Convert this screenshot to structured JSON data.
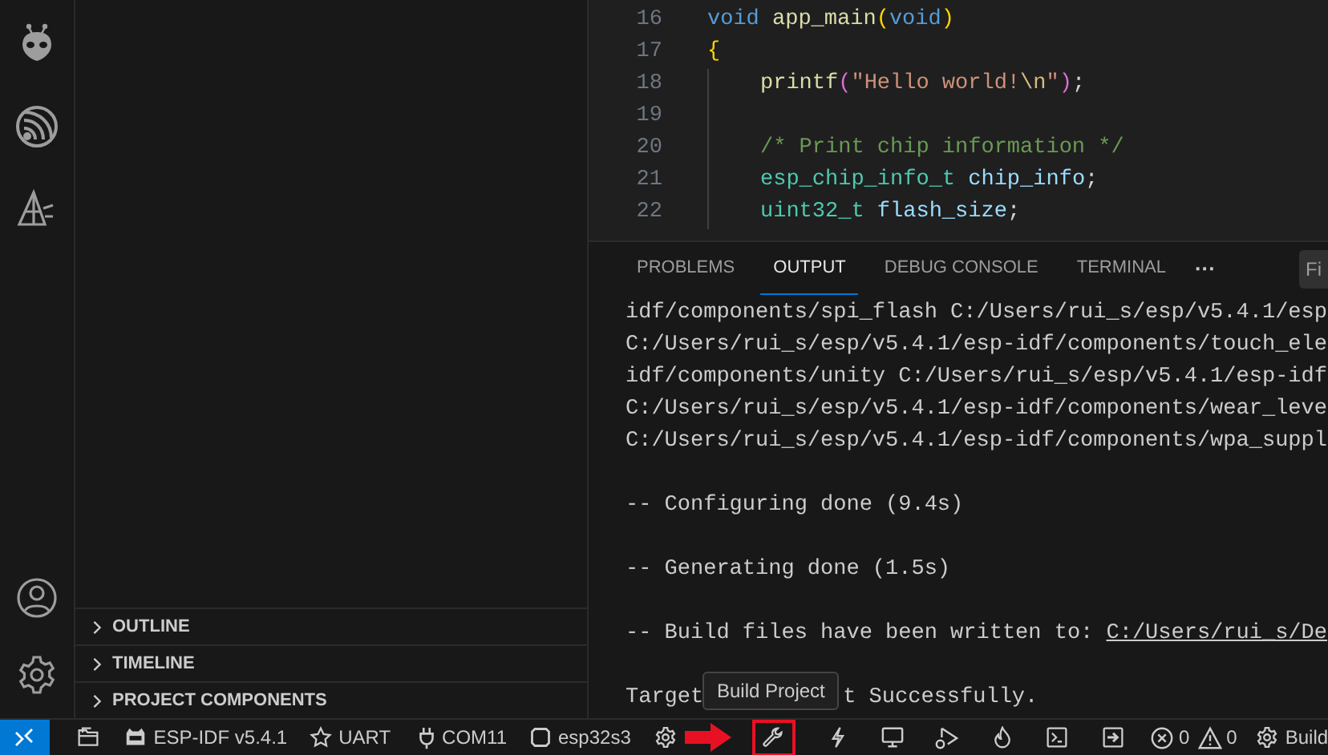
{
  "activity_bar": {
    "top": [
      {
        "kind": "alien"
      },
      {
        "kind": "espressif"
      },
      {
        "kind": "triangle"
      }
    ],
    "bottom": [
      {
        "kind": "account"
      },
      {
        "kind": "settings"
      }
    ]
  },
  "sidebar": {
    "sections": [
      {
        "label": "OUTLINE",
        "expanded": false
      },
      {
        "label": "TIMELINE",
        "expanded": false
      },
      {
        "label": "PROJECT COMPONENTS",
        "expanded": false
      }
    ]
  },
  "editor": {
    "lines": [
      {
        "number": "16",
        "indented": false,
        "tokens": [
          {
            "text": "void",
            "kind": "keyword"
          },
          {
            "text": " app_main",
            "kind": "function"
          },
          {
            "text": "(",
            "kind": "bracket"
          },
          {
            "text": "void",
            "kind": "keyword"
          },
          {
            "text": ")",
            "kind": "bracket"
          }
        ]
      },
      {
        "number": "17",
        "indented": false,
        "tokens": [
          {
            "text": "{",
            "kind": "bracket"
          }
        ]
      },
      {
        "number": "18",
        "indented": true,
        "tokens": [
          {
            "text": "printf",
            "kind": "function"
          },
          {
            "text": "(",
            "kind": "bracket2"
          },
          {
            "text": "\"Hello world!",
            "kind": "string"
          },
          {
            "text": "\\n",
            "kind": "escape"
          },
          {
            "text": "\"",
            "kind": "string"
          },
          {
            "text": ")",
            "kind": "bracket2"
          },
          {
            "text": ";",
            "kind": "plain"
          }
        ]
      },
      {
        "number": "19",
        "indented": true
      },
      {
        "number": "20",
        "indented": true,
        "tokens": [
          {
            "text": "/* Print chip information */",
            "kind": "comment"
          }
        ]
      },
      {
        "number": "21",
        "indented": true,
        "tokens": [
          {
            "text": "esp_chip_info_t",
            "kind": "type"
          },
          {
            "text": " chip_info",
            "kind": "variable"
          },
          {
            "text": ";",
            "kind": "plain"
          }
        ]
      },
      {
        "number": "22",
        "indented": true,
        "tokens": [
          {
            "text": "uint32_t",
            "kind": "type"
          },
          {
            "text": " flash_size",
            "kind": "variable"
          },
          {
            "text": ";",
            "kind": "plain"
          }
        ]
      }
    ]
  },
  "panel": {
    "tabs": [
      {
        "label": "PROBLEMS",
        "selected": false
      },
      {
        "label": "OUTPUT",
        "selected": true
      },
      {
        "label": "DEBUG CONSOLE",
        "selected": false
      },
      {
        "label": "TERMINAL",
        "selected": false
      }
    ],
    "more": "···",
    "filter": {
      "placeholder": "Fi"
    },
    "output": [
      {
        "text": "idf/components/spi_flash C:/Users/rui_s/esp/v5.4.1/esp"
      },
      {
        "text": "C:/Users/rui_s/esp/v5.4.1/esp-idf/components/touch_ele"
      },
      {
        "text": "idf/components/unity C:/Users/rui_s/esp/v5.4.1/esp-idf"
      },
      {
        "text": "C:/Users/rui_s/esp/v5.4.1/esp-idf/components/wear_leve"
      },
      {
        "text": "C:/Users/rui_s/esp/v5.4.1/esp-idf/components/wpa_suppl"
      },
      {
        "text": "-- Configuring done (9.4s)"
      },
      {
        "text": "-- Generating done (1.5s)"
      },
      {
        "text": "-- Build files have been written to: ",
        "link": "C:/Users/rui_s/De"
      },
      {
        "text": "Target",
        "after_tooltip": "t Successfully."
      }
    ]
  },
  "tooltip": "Build Project",
  "status_bar": {
    "items": [
      {
        "kind": "folder",
        "highlighted": false
      },
      {
        "kind": "idf",
        "label": "ESP-IDF v5.4.1",
        "highlighted": false
      },
      {
        "kind": "star",
        "label": "UART",
        "highlighted": false
      },
      {
        "kind": "plug",
        "label": "COM11",
        "highlighted": false
      },
      {
        "kind": "chip",
        "label": "esp32s3",
        "highlighted": false
      },
      {
        "kind": "gear",
        "highlighted": false
      },
      {
        "kind": "wrench",
        "highlighted": true
      },
      {
        "kind": "bolt",
        "highlighted": false
      },
      {
        "kind": "monitor",
        "highlighted": false
      },
      {
        "kind": "debug",
        "highlighted": false
      },
      {
        "kind": "flame",
        "highlighted": false
      },
      {
        "kind": "terminal",
        "highlighted": false
      },
      {
        "kind": "enter",
        "highlighted": false
      },
      {
        "kind": "problems",
        "errors": "0",
        "warnings": "0",
        "highlighted": false
      },
      {
        "kind": "gear",
        "label": "Build",
        "highlighted": false
      }
    ]
  }
}
